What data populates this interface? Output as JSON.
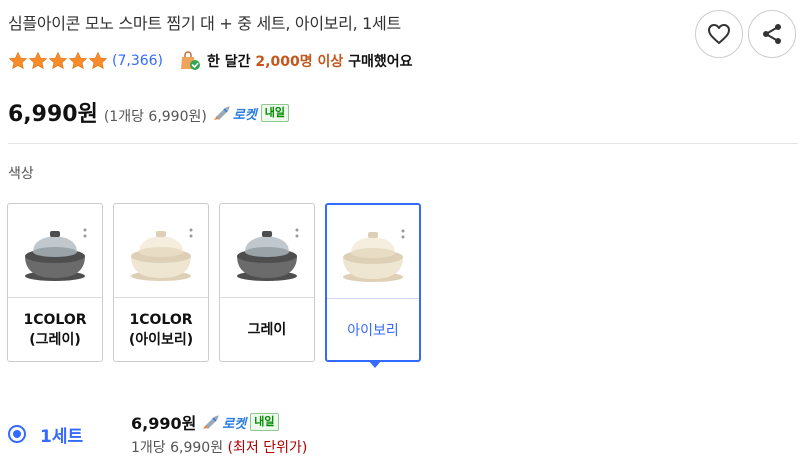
{
  "product": {
    "title": "심플아이콘 모노 스마트 찜기 대 + 중 세트, 아이보리, 1세트",
    "review_count": "(7,366)",
    "rating_stars": 5,
    "purchase_prefix": "한 달간",
    "purchase_count": "2,000명 이상",
    "purchase_suffix": "구매했어요",
    "price": "6,990원",
    "unit_price": "(1개당 6,990원)",
    "rocket_label": "로켓",
    "tomorrow_badge": "내일"
  },
  "colors": {
    "accent": "#346aff",
    "star": "#f98b2a",
    "highlight": "#c3571d",
    "badge_green": "#008c00",
    "lowest_red": "#ae0000"
  },
  "options": {
    "label": "색상",
    "items": [
      {
        "label": "1COLOR(그레이)",
        "kind": "gray",
        "selected": false
      },
      {
        "label": "1COLOR(아이보리)",
        "kind": "ivory",
        "selected": false
      },
      {
        "label": "그레이",
        "kind": "gray",
        "selected": false
      },
      {
        "label": "아이보리",
        "kind": "ivory",
        "selected": true
      }
    ]
  },
  "quantity": {
    "label": "1세트",
    "price": "6,990원",
    "rocket_label": "로켓",
    "tomorrow_badge": "내일",
    "unit_price": "1개당 6,990원",
    "lowest_tag": "(최저 단위가)"
  },
  "icons": {
    "like": "heart-icon",
    "share": "share-icon",
    "bag": "shopping-bag-check-icon",
    "rocket": "rocket-icon"
  }
}
